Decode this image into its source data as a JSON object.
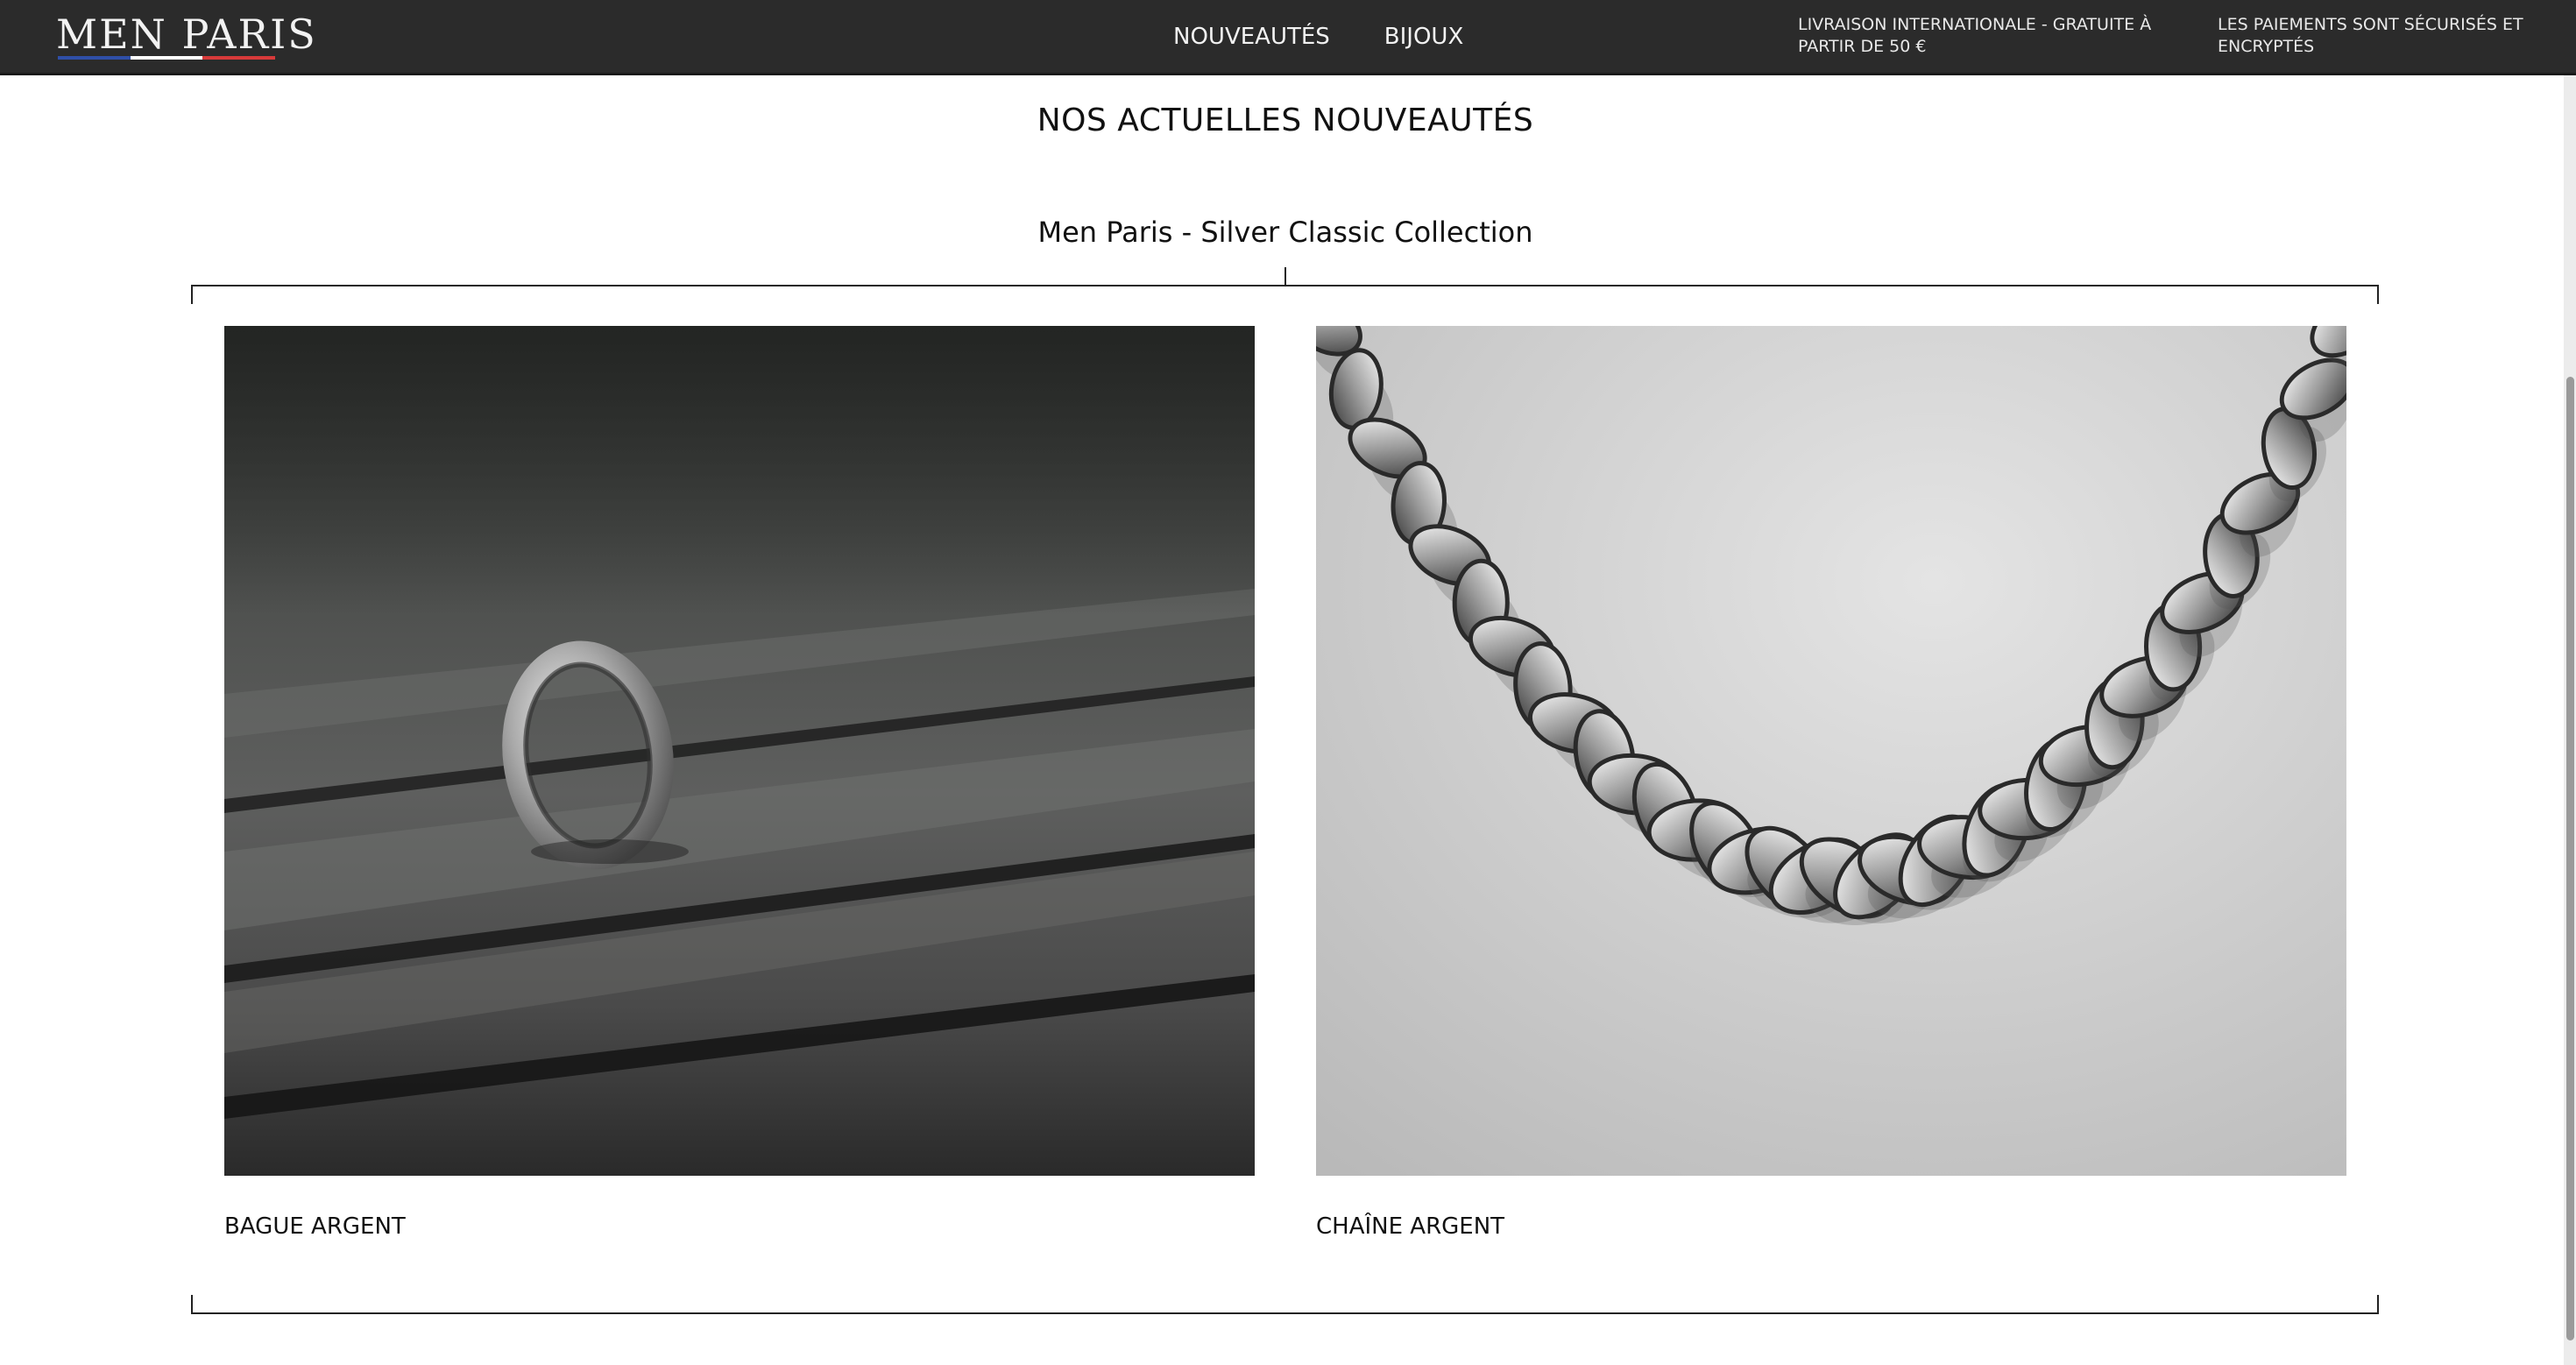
{
  "header": {
    "logo": "MEN PARIS",
    "flag_colors": [
      "#2f4fa8",
      "#ffffff",
      "#d83a3a"
    ],
    "nav": [
      {
        "label": "NOUVEAUTÉS"
      },
      {
        "label": "BIJOUX"
      }
    ],
    "notices": [
      {
        "line1": "LIVRAISON INTERNATIONALE - GRATUITE À",
        "line2": "PARTIR DE 50 €"
      },
      {
        "line1": "LES PAIEMENTS SONT SÉCURISÉS ET",
        "line2": "ENCRYPTÉS"
      }
    ]
  },
  "main": {
    "heading": "NOS ACTUELLES NOUVEAUTÉS",
    "collection_title": "Men Paris - Silver Classic Collection",
    "products": [
      {
        "name": "BAGUE ARGENT",
        "image_icon": "silver-ring-photo"
      },
      {
        "name": "CHAÎNE ARGENT",
        "image_icon": "silver-chain-photo"
      }
    ]
  },
  "colors": {
    "header_bg": "#2b2b2b",
    "header_text": "#f2f2f2",
    "page_bg": "#ffffff"
  }
}
